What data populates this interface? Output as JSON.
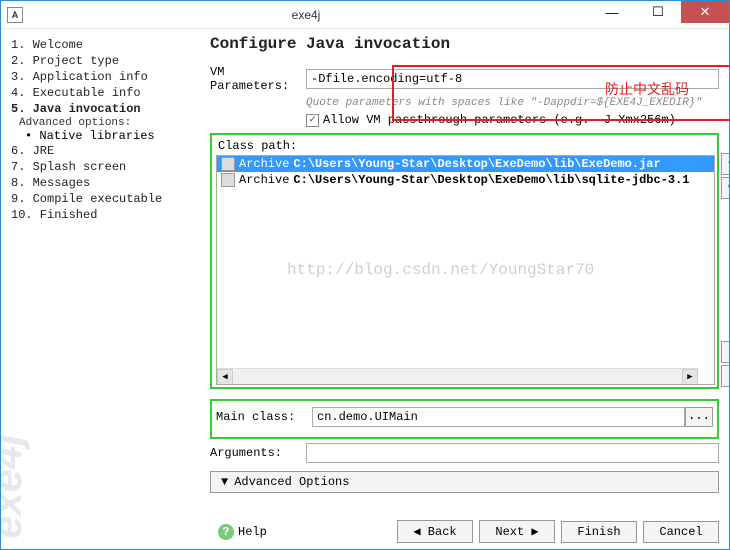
{
  "window": {
    "title": "exe4j",
    "icon_letter": "A"
  },
  "sidebar": {
    "items": [
      "1. Welcome",
      "2. Project type",
      "3. Application info",
      "4. Executable info",
      "5. Java invocation",
      "6. JRE",
      "7. Splash screen",
      "8. Messages",
      "9. Compile executable",
      "10. Finished"
    ],
    "adv_label": "Advanced options:",
    "adv_item": "• Native libraries",
    "brand": "exe4j"
  },
  "main": {
    "heading": "Configure Java invocation",
    "vm_params_label": "VM Parameters:",
    "vm_params_value": "-Dfile.encoding=utf-8",
    "vm_hint": "Quote parameters with spaces like \"-Dappdir=${EXE4J_EXEDIR}\"",
    "allow_passthrough_label": "Allow VM passthrough parameters (e.g. -J-Xmx256m)",
    "allow_passthrough_checked": true,
    "classpath_label": "Class path:",
    "classpath_items": [
      {
        "prefix": "Archive",
        "path": "C:\\Users\\Young-Star\\Desktop\\ExeDemo\\lib\\ExeDemo.jar",
        "selected": true
      },
      {
        "prefix": "Archive",
        "path": "C:\\Users\\Young-Star\\Desktop\\ExeDemo\\lib\\sqlite-jdbc-3.1",
        "selected": false
      }
    ],
    "mainclass_label": "Main class:",
    "mainclass_value": "cn.demo.UIMain",
    "arguments_label": "Arguments:",
    "arguments_value": "",
    "adv_options_label": "Advanced Options",
    "watermark": "http://blog.csdn.net/YoungStar70"
  },
  "footer": {
    "help": "Help",
    "back": "◀ Back",
    "next": "Next ▶",
    "finish": "Finish",
    "cancel": "Cancel"
  },
  "annotations": {
    "red_text": "防止中文乱码"
  },
  "icons": {
    "add": "+",
    "edit": "✎",
    "up": "⬆",
    "down": "⬇",
    "check": "✓"
  }
}
